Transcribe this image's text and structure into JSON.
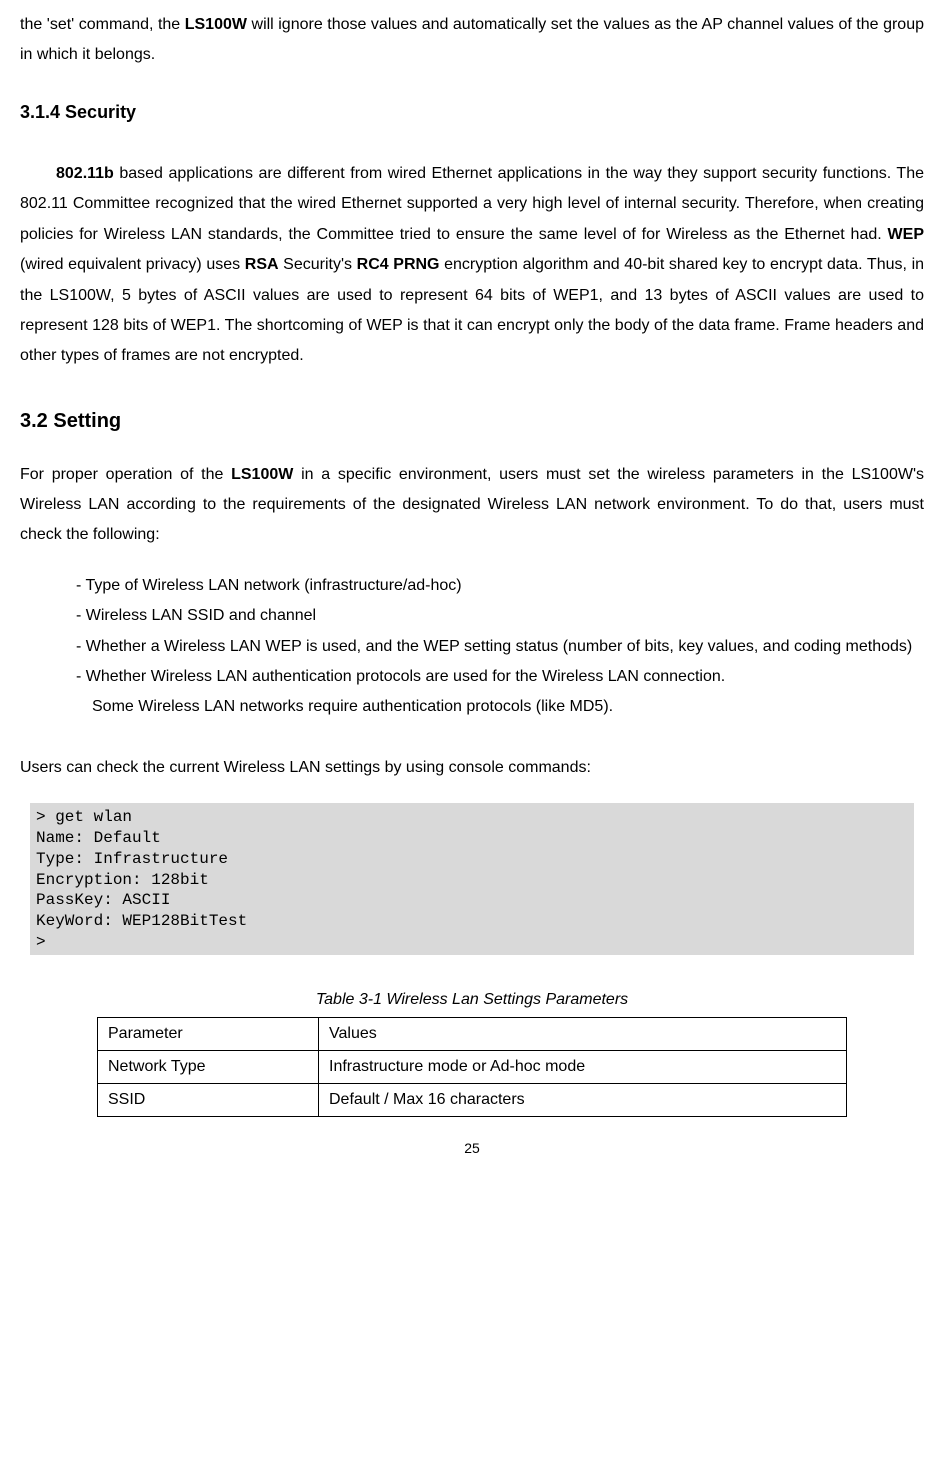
{
  "intro_before_bold": "the 'set' command, the ",
  "intro_bold": "LS100W",
  "intro_after_bold": " will ignore those values and automatically set the values as the AP channel values of the group in which it belongs.",
  "h_314": "3.1.4 Security",
  "p314_indent_before": "",
  "p314_b1": "802.11b",
  "p314_t1": " based applications are different from wired Ethernet applications in the way they support security functions. The 802.11 Committee recognized that the wired Ethernet supported a very high level of internal security. Therefore, when creating policies for Wireless LAN standards, the Committee tried to ensure the same level of for Wireless as the Ethernet had.   ",
  "p314_b2": "WEP",
  "p314_t2": " (wired equivalent privacy) uses ",
  "p314_b3": "RSA",
  "p314_t3": " Security's ",
  "p314_b4": "RC4 PRNG",
  "p314_t4": " encryption algorithm and 40-bit shared key to encrypt data. Thus, in the LS100W, 5 bytes of ASCII values are used to represent 64 bits of WEP1, and 13 bytes of ASCII values are used to represent 128 bits of WEP1. The shortcoming of WEP is that it can encrypt only the body of the data frame. Frame headers and other types of frames are not encrypted.",
  "h_32": "3.2 Setting",
  "p32_t1": "For proper operation of the ",
  "p32_b1": "LS100W",
  "p32_t2": " in a specific environment, users must set the wireless parameters in the LS100W's Wireless LAN according to the requirements of the designated Wireless LAN network environment. To do that, users must check the following:",
  "bullets": {
    "i1": "- Type of Wireless LAN network (infrastructure/ad-hoc)",
    "i2": "- Wireless LAN SSID and channel",
    "i3": "- Whether a Wireless LAN WEP is used, and the WEP setting status (number of bits, key values, and coding methods)",
    "i4": "- Whether Wireless LAN authentication protocols are used for the Wireless LAN connection.",
    "i5": "Some Wireless LAN networks require authentication protocols (like MD5)."
  },
  "p_console": "Users can check the current Wireless LAN settings by using console commands:",
  "code": "> get wlan\nName: Default\nType: Infrastructure\nEncryption: 128bit\nPassKey: ASCII\nKeyWord: WEP128BitTest\n>",
  "table_caption": "Table 3-1 Wireless Lan Settings Parameters",
  "table": {
    "r0c0": "Parameter",
    "r0c1": "Values",
    "r1c0": "Network Type",
    "r1c1": "Infrastructure mode or Ad-hoc mode",
    "r2c0": "SSID",
    "r2c1": "Default / Max 16 characters"
  },
  "page_num": "25"
}
